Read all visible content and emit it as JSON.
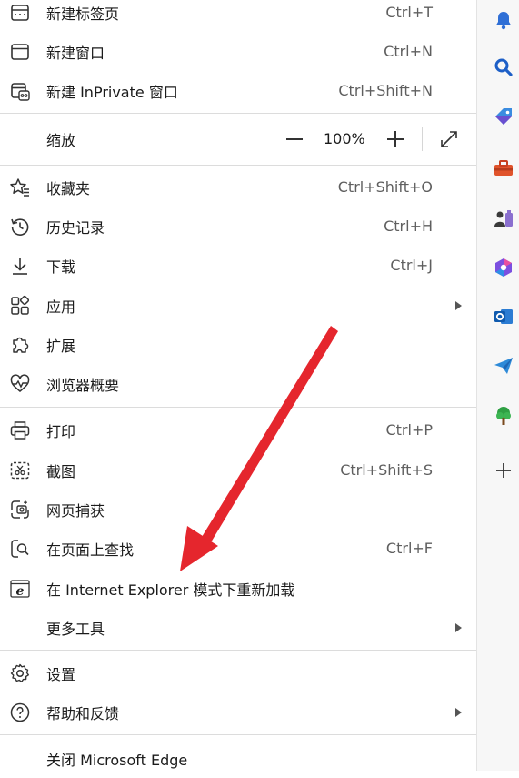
{
  "menu": {
    "items_top": [
      {
        "label": "新建标签页",
        "shortcut": "Ctrl+T",
        "icon": "new-tab-icon"
      },
      {
        "label": "新建窗口",
        "shortcut": "Ctrl+N",
        "icon": "new-window-icon"
      },
      {
        "label": "新建 InPrivate 窗口",
        "shortcut": "Ctrl+Shift+N",
        "icon": "inprivate-icon"
      }
    ],
    "zoom": {
      "label": "缩放",
      "value": "100%",
      "icon_minus": "zoom-out-icon",
      "icon_plus": "zoom-in-icon",
      "icon_full": "fullscreen-icon"
    },
    "items_mid": [
      {
        "label": "收藏夹",
        "shortcut": "Ctrl+Shift+O",
        "icon": "favorites-icon"
      },
      {
        "label": "历史记录",
        "shortcut": "Ctrl+H",
        "icon": "history-icon"
      },
      {
        "label": "下载",
        "shortcut": "Ctrl+J",
        "icon": "download-icon"
      },
      {
        "label": "应用",
        "shortcut": "",
        "icon": "apps-icon",
        "submenu": true
      },
      {
        "label": "扩展",
        "shortcut": "",
        "icon": "extensions-icon"
      },
      {
        "label": "浏览器概要",
        "shortcut": "",
        "icon": "browser-essentials-icon"
      }
    ],
    "items_tools": [
      {
        "label": "打印",
        "shortcut": "Ctrl+P",
        "icon": "print-icon"
      },
      {
        "label": "截图",
        "shortcut": "Ctrl+Shift+S",
        "icon": "screenshot-icon"
      },
      {
        "label": "网页捕获",
        "shortcut": "",
        "icon": "web-capture-icon"
      },
      {
        "label": "在页面上查找",
        "shortcut": "Ctrl+F",
        "icon": "find-icon"
      },
      {
        "label": "在 Internet Explorer 模式下重新加载",
        "shortcut": "",
        "icon": "ie-icon"
      },
      {
        "label": "更多工具",
        "shortcut": "",
        "icon": "",
        "submenu": true
      }
    ],
    "items_bottom": [
      {
        "label": "设置",
        "shortcut": "",
        "icon": "settings-icon"
      },
      {
        "label": "帮助和反馈",
        "shortcut": "",
        "icon": "help-icon",
        "submenu": true
      },
      {
        "label": "关闭 Microsoft Edge",
        "shortcut": "",
        "icon": ""
      }
    ]
  },
  "sidebar": {
    "icons": [
      "bell-icon",
      "search-icon",
      "tag-icon",
      "toolbox-icon",
      "games-icon",
      "copilot-icon",
      "outlook-icon",
      "send-icon",
      "tree-icon",
      "add-icon"
    ]
  },
  "annotation": {
    "arrow_color": "#e5262d"
  }
}
